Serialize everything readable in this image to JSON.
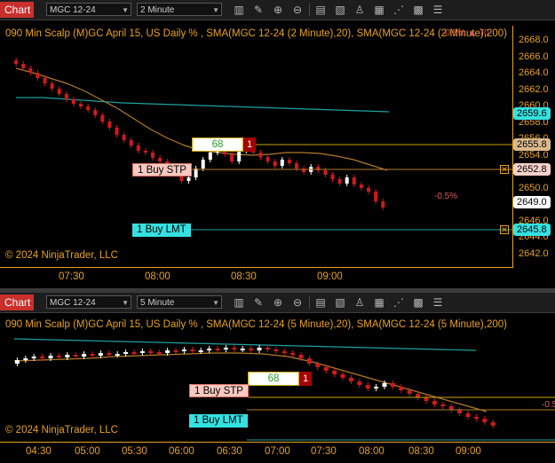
{
  "colors": {
    "accent": "#e8a21a",
    "bull": "#ffffff",
    "bear": "#d01a1a",
    "sma20": "#b07a2a",
    "sma200": "#1fa0a0",
    "cyan": "#35e0e0"
  },
  "panel1": {
    "tab": "Chart",
    "instrument": "MGC 12-24",
    "interval": "2 Minute",
    "title": "090 Min Scalp (M)GC April 15, US Daily % , SMA(MGC 12-24 (2 Minute),20), SMA(MGC 12-24 (2 Minute),200)",
    "title_overlay": "-0.5% ▲ 70",
    "copyright": "© 2024 NinjaTrader, LLC",
    "y_labels": [
      "2668.0",
      "2666.0",
      "2664.0",
      "2662.0",
      "2660.0",
      "2658.0",
      "2656.0",
      "2654.0",
      "2652.0",
      "2650.0",
      "2648.0",
      "2646.0",
      "2644.0",
      "2642.0"
    ],
    "x_labels": [
      "07:30",
      "08:00",
      "08:30",
      "09:00"
    ],
    "price_tags": [
      "2659.6",
      "2655.8",
      "2652.8",
      "2649.0",
      "2645.8"
    ],
    "pct_label": "-0.5%",
    "qty": "68",
    "qty_close": "1",
    "stop_order": "1 Buy STP",
    "limit_order": "1 Buy LMT",
    "close_x": "✕"
  },
  "panel2": {
    "tab": "Chart",
    "instrument": "MGC 12-24",
    "interval": "5 Minute",
    "title": "090 Min Scalp (M)GC April 15, US Daily % , SMA(MGC 12-24 (5 Minute),20), SMA(MGC 12-24 (5 Minute),200)",
    "copyright": "© 2024 NinjaTrader, LLC",
    "x_labels": [
      "04:30",
      "05:00",
      "05:30",
      "06:00",
      "06:30",
      "07:00",
      "07:30",
      "08:00",
      "08:30",
      "09:00"
    ],
    "pct_label": "-0.5",
    "qty": "68",
    "qty_close": "1",
    "stop_order": "1 Buy STP",
    "limit_order": "1 Buy LMT"
  },
  "toolbar_icons": [
    "bar-chart-icon",
    "pencil-icon",
    "zoom-in-icon",
    "zoom-out-icon",
    "properties-icon",
    "template-icon",
    "strategy-icon",
    "drawing-tool-icon",
    "grid-icon",
    "list-icon"
  ]
}
